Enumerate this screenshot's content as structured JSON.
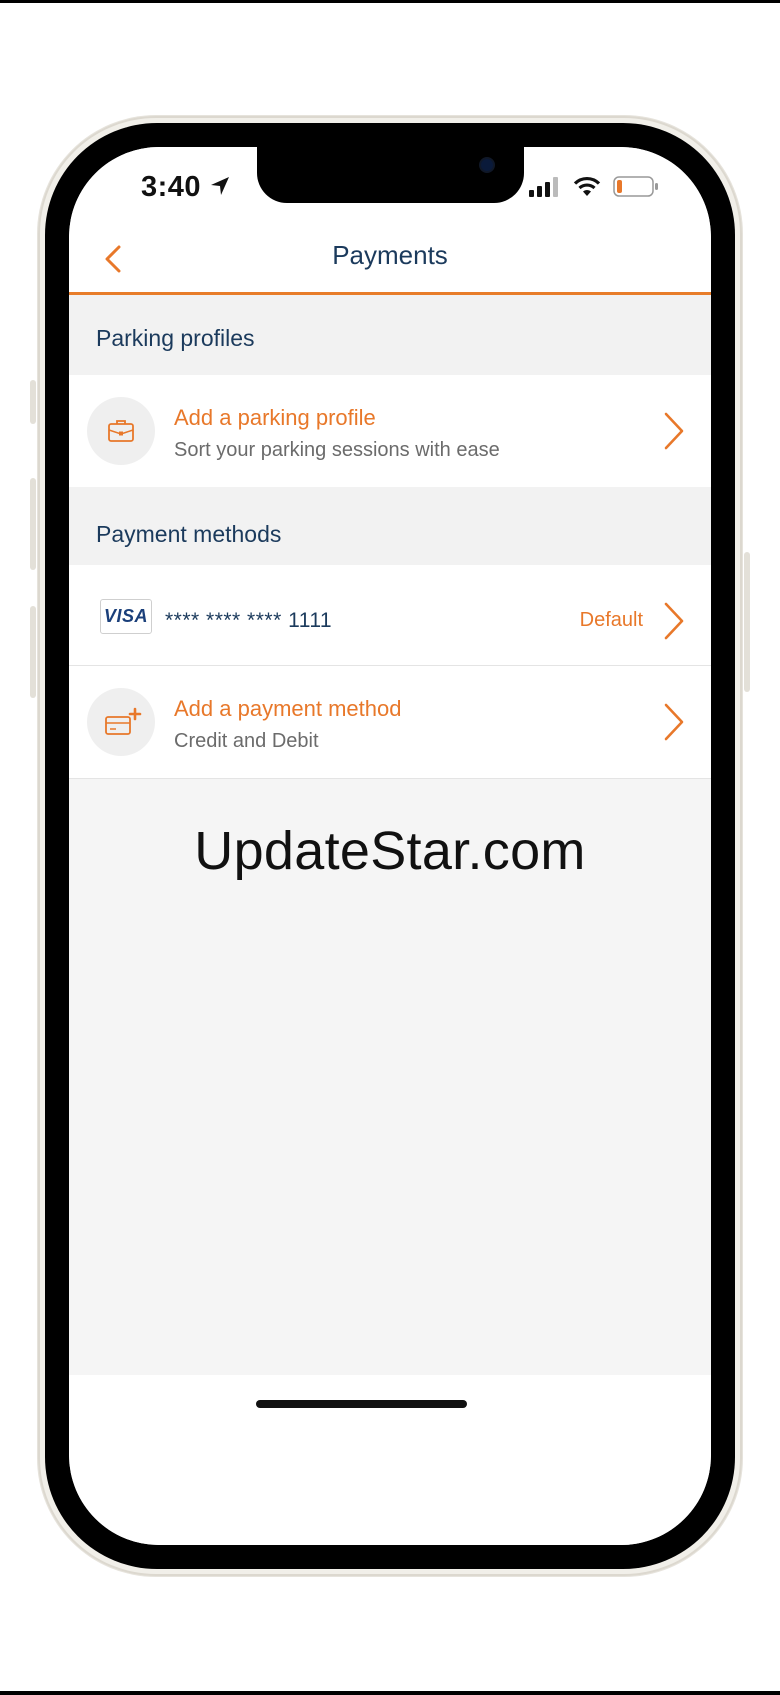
{
  "status_bar": {
    "time": "3:40",
    "icons": [
      "location-arrow-icon",
      "signal-icon",
      "wifi-icon",
      "battery-icon"
    ]
  },
  "header": {
    "title": "Payments",
    "back_icon": "chevron-left-icon"
  },
  "parking_profiles": {
    "section_title": "Parking profiles",
    "add_row": {
      "icon": "briefcase-icon",
      "title": "Add a parking profile",
      "subtitle": "Sort your parking sessions with ease"
    }
  },
  "payment_methods": {
    "section_title": "Payment methods",
    "card": {
      "brand": "VISA",
      "number": "**** **** **** 1111",
      "default_label": "Default"
    },
    "add_row": {
      "icon": "add-card-icon",
      "title": "Add a payment method",
      "subtitle": "Credit and Debit"
    }
  },
  "watermark": "UpdateStar.com",
  "colors": {
    "accent": "#e8782a",
    "navy": "#1b3a5c",
    "section_bg": "#f2f2f2"
  }
}
